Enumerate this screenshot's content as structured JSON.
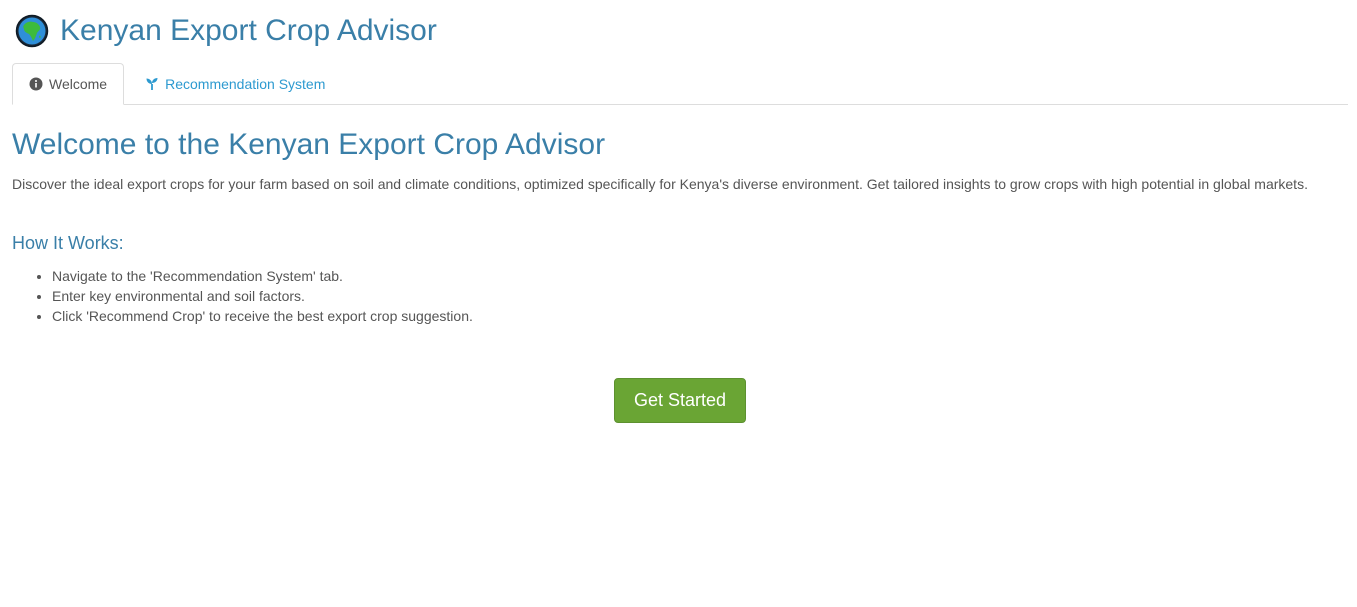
{
  "header": {
    "title": "Kenyan Export Crop Advisor",
    "icon": "globe-africa-icon"
  },
  "tabs": [
    {
      "label": "Welcome",
      "icon": "info-circle-icon",
      "active": true
    },
    {
      "label": "Recommendation System",
      "icon": "seedling-icon",
      "active": false
    }
  ],
  "main": {
    "heading": "Welcome to the Kenyan Export Crop Advisor",
    "intro": "Discover the ideal export crops for your farm based on soil and climate conditions, optimized specifically for Kenya's diverse environment. Get tailored insights to grow crops with high potential in global markets.",
    "how_heading": "How It Works:",
    "steps": [
      "Navigate to the 'Recommendation System' tab.",
      "Enter key environmental and soil factors.",
      "Click 'Recommend Crop' to receive the best export crop suggestion."
    ],
    "cta_label": "Get Started"
  },
  "colors": {
    "heading": "#3a7fa8",
    "link": "#2d9ad0",
    "button": "#6aa534",
    "text": "#555555"
  }
}
